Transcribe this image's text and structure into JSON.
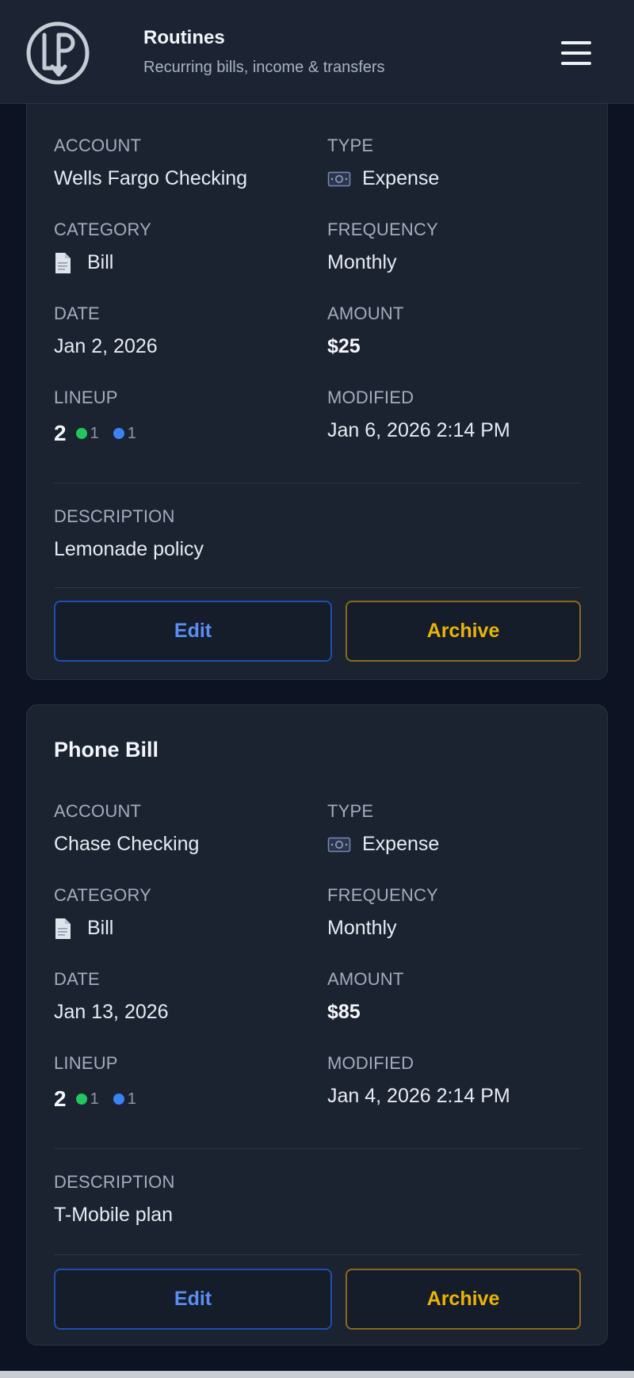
{
  "header": {
    "title": "Routines",
    "subtitle": "Recurring bills, income & transfers",
    "logo_text": "LP"
  },
  "labels": {
    "account": "ACCOUNT",
    "type": "TYPE",
    "category": "CATEGORY",
    "frequency": "FREQUENCY",
    "date": "DATE",
    "amount": "AMOUNT",
    "lineup": "LINEUP",
    "modified": "MODIFIED",
    "description": "DESCRIPTION",
    "edit": "Edit",
    "archive": "Archive"
  },
  "colors": {
    "background": "#0d1322",
    "card": "#1b2230",
    "edit_accent": "#5b8ef0",
    "archive_accent": "#eab308",
    "lineup_green": "#22c55e",
    "lineup_blue": "#3b82f6"
  },
  "cards": [
    {
      "title": "",
      "account": "Wells Fargo Checking",
      "type": "Expense",
      "type_icon": "money-icon",
      "category": "Bill",
      "category_icon": "document-icon",
      "frequency": "Monthly",
      "date": "Jan 2, 2026",
      "amount": "$25",
      "lineup_total": "2",
      "lineup_green": "1",
      "lineup_blue": "1",
      "modified": "Jan 6, 2026 2:14 PM",
      "description": "Lemonade policy"
    },
    {
      "title": "Phone Bill",
      "account": "Chase Checking",
      "type": "Expense",
      "type_icon": "money-icon",
      "category": "Bill",
      "category_icon": "document-icon",
      "frequency": "Monthly",
      "date": "Jan 13, 2026",
      "amount": "$85",
      "lineup_total": "2",
      "lineup_green": "1",
      "lineup_blue": "1",
      "modified": "Jan 4, 2026 2:14 PM",
      "description": "T-Mobile plan"
    }
  ]
}
